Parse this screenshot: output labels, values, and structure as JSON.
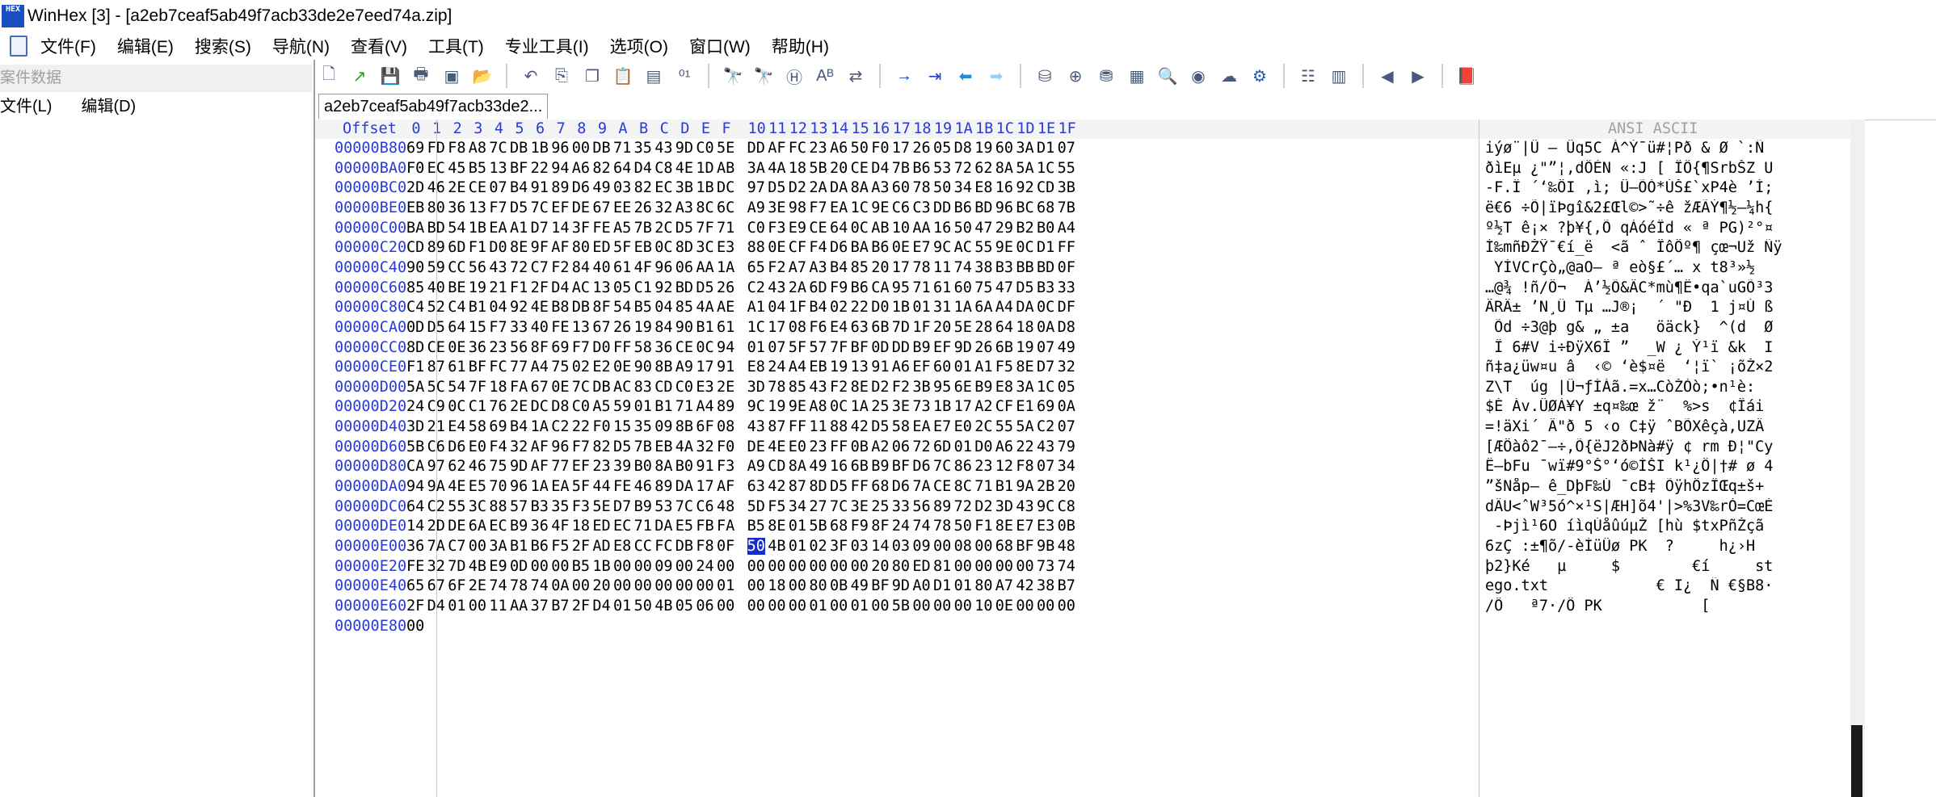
{
  "window": {
    "title": "WinHex [3] - [a2eb7ceaf5ab49f7acb33de2e7eed74a.zip]",
    "logo_text": "HEX"
  },
  "menu": [
    "文件(F)",
    "编辑(E)",
    "搜索(S)",
    "导航(N)",
    "查看(V)",
    "工具(T)",
    "专业工具(I)",
    "选项(O)",
    "窗口(W)",
    "帮助(H)"
  ],
  "toolbar_icons": [
    "new-file-icon",
    "open-icon",
    "save-icon",
    "print-icon",
    "properties-icon",
    "open-folder-icon",
    "undo-icon",
    "copy-icon",
    "copy-block-icon",
    "paste-icon",
    "paste-hex-icon",
    "binary-icon",
    "find-icon",
    "find-replace-icon",
    "find-hex-icon",
    "replace-text-icon",
    "replace-hex-icon",
    "goto-offset-icon",
    "goto-block-icon",
    "back-arrow-icon",
    "forward-arrow-icon",
    "disk-icon",
    "disk-add-icon",
    "disk-clone-icon",
    "calculator-icon",
    "zoom-icon",
    "zoom-out-icon",
    "hand-icon",
    "gear-icon",
    "data-view-icon",
    "table-icon",
    "prev-icon",
    "next-icon",
    "help-book-icon"
  ],
  "left_panel": {
    "header": "案件数据",
    "menu": [
      "文件(L)",
      "编辑(D)"
    ]
  },
  "tab": {
    "label": "a2eb7ceaf5ab49f7acb33de2..."
  },
  "hex": {
    "header_offset": "Offset",
    "header_cols": [
      "0",
      "1",
      "2",
      "3",
      "4",
      "5",
      "6",
      "7",
      "8",
      "9",
      "A",
      "B",
      "C",
      "D",
      "E",
      "F",
      "10",
      "11",
      "12",
      "13",
      "14",
      "15",
      "16",
      "17",
      "18",
      "19",
      "1A",
      "1B",
      "1C",
      "1D",
      "1E",
      "1F"
    ],
    "header_ansi": "ANSI ASCII",
    "rows": [
      {
        "o": "00000B80",
        "h": "69 FD F8 A8 7C DB 1B 96 00 DB 71 35 43 9D C0 5E DD AF FC 23 A6 50 F0 17 26 05 D8 19 60 3A D1 07",
        "a": "iýø¨|Û – Ûq5C À^Ý¯ü#¦Pð & Ø `:Ñ"
      },
      {
        "o": "00000BA0",
        "h": "F0 EC 45 B5 13 BF 22 94 A6 82 64 D4 C8 4E 1D AB 3A 4A 18 5B 20 CE D4 7B B6 53 72 62 8A 5A 1C 55",
        "a": "ðìEµ ¿\"”¦‚dÔÈN «:J [ ÎÔ{¶SrbŠZ U"
      },
      {
        "o": "00000BC0",
        "h": "2D 46 2E CE 07 B4 91 89 D6 49 03 82 EC 3B 1B DC 97 D5 D2 2A DA 8A A3 60 78 50 34 E8 16 92 CD 3B",
        "a": "-F.Î ´‘‰ÖI ‚ì; Ü—ÕÒ*ÚŠ£`xP4è ’Í;"
      },
      {
        "o": "00000BE0",
        "h": "EB 80 36 13 F7 D5 7C EF DE 67 EE 26 32 A3 8C 6C A9 3E 98 F7 EA 1C 9E C6 C3 DD B6 BD 96 BC 68 7B",
        "a": "ë€6 ÷Õ|ïÞgî&2£Œl©>˜÷ê žÆÃÝ¶½–¼h{"
      },
      {
        "o": "00000C00",
        "h": "BA BD 54 1B EA A1 D7 14 3F FE A5 7B 2C D5 7F 71 C0 F3 E9 CE 64 0C AB 10 AA 16 50 47 29 B2 B0 A4",
        "a": "º½T ê¡× ?þ¥{,Õ qÀóéÎd « ª PG)²°¤"
      },
      {
        "o": "00000C20",
        "h": "CD 89 6D F1 D0 8E 9F AF 80 ED 5F EB 0C 8D 3C E3 88 0E CF F4 D6 BA B6 0E E7 9C AC 55 9E 0C D1 FF",
        "a": "Í‰mñÐŽŸ¯€í_ë  <ã ˆ ÏôÖº¶ çœ¬Už Ñÿ"
      },
      {
        "o": "00000C40",
        "h": "90 59 CC 56 43 72 C7 F2 84 40 61 4F 96 06 AA 1A 65 F2 A7 A3 B4 85 20 17 78 11 74 38 B3 BB BD 0F",
        "a": " YÌVCrÇò„@aO– ª eò§£´… x t8³»½"
      },
      {
        "o": "00000C60",
        "h": "85 40 BE 19 21 F1 2F D4 AC 13 05 C1 92 BD D5 26 C2 43 2A 6D F9 B6 CA 95 71 61 60 75 47 D5 B3 33",
        "a": "…@¾ !ñ/Ô¬  Á’½Õ&ÂC*mù¶Ê•qa`uGÕ³3"
      },
      {
        "o": "00000C80",
        "h": "C4 52 C4 B1 04 92 4E B8 DB 8F 54 B5 04 85 4A AE A1 04 1F B4 02 22 D0 1B 01 31 1A 6A A4 DA 0C DF",
        "a": "ÄRÄ± ’N¸Û Tµ …J®¡  ´ \"Ð  1 j¤Ú ß"
      },
      {
        "o": "00000CA0",
        "h": "0D D5 64 15 F7 33 40 FE 13 67 26 19 84 90 B1 61 1C 17 08 F6 E4 63 6B 7D 1F 20 5E 28 64 18 0A D8",
        "a": " Õd ÷3@þ g& „ ±a   öäck}  ^(d  Ø"
      },
      {
        "o": "00000CC0",
        "h": "8D CE 0E 36 23 56 8F 69 F7 D0 FF 58 36 CE 0C 94 01 07 5F 57 7F BF 0D DD B9 EF 9D 26 6B 19 07 49",
        "a": " Î 6#V i÷ÐÿX6Î ”  _W ¿ Ý¹ï &k  I"
      },
      {
        "o": "00000CE0",
        "h": "F1 87 61 BF FC 77 A4 75 02 E2 0E 90 8B A9 17 91 E8 24 A4 EB 19 13 91 A6 EF 60 01 A1 F5 8E D7 32",
        "a": "ñ‡a¿üw¤u â  ‹© ‘è$¤ë  ‘¦ï` ¡õŽ×2"
      },
      {
        "o": "00000D00",
        "h": "5A 5C 54 7F 18 FA 67 0E 7C DB AC 83 CD C0 E3 2E 3D 78 85 43 F2 8E D2 F2 3B 95 6E B9 E8 3A 1C 05",
        "a": "Z\\T  úg |Û¬ƒÍÀã.=x…CòŽÒò;•n¹è:  "
      },
      {
        "o": "00000D20",
        "h": "24 C9 0C C1 76 2E DC D8 C0 A5 59 01 B1 71 A4 89 9C 19 9E A8 0C 1A 25 3E 73 1B 17 A2 CF E1 69 0A",
        "a": "$É Áv.ÜØÀ¥Y ±q¤‰œ ž¨  %>s  ¢Ïái "
      },
      {
        "o": "00000D40",
        "h": "3D 21 E4 58 69 B4 1A C2 22 F0 15 35 09 8B 6F 08 43 87 FF 11 88 42 D5 58 EA E7 E0 2C 55 5A C2 07",
        "a": "=!äXi´ Â\"ð 5 ‹o C‡ÿ ˆBÕXêçà,UZÂ "
      },
      {
        "o": "00000D60",
        "h": "5B C6 D6 E0 F4 32 AF 96 F7 82 D5 7B EB 4A 32 F0 DE 4E E0 23 FF 0B A2 06 72 6D 01 D0 A6 22 43 79",
        "a": "[ÆÖàô2¯–÷‚Õ{ëJ2ðÞNà#ÿ ¢ rm Ð¦\"Cy"
      },
      {
        "o": "00000D80",
        "h": "CA 97 62 46 75 9D AF 77 EF 23 39 B0 8A B0 91 F3 A9 CD 8A 49 16 6B B9 BF D6 7C 86 23 12 F8 07 34",
        "a": "Ê—bFu ¯wï#9°Š°‘ó©ÍŠI k¹¿Ö|†# ø 4"
      },
      {
        "o": "00000DA0",
        "h": "94 9A 4E E5 70 96 1A EA 5F 44 FE 46 89 DA 17 AF 63 42 87 8D D5 FF 68 D6 7A CE 8C 71 B1 9A 2B 20",
        "a": "”šNåp– ê_DþF‰Ú ¯cB‡ ÕÿhÖzÎŒq±š+ "
      },
      {
        "o": "00000DC0",
        "h": "64 C2 55 3C 88 57 B3 35 F3 5E D7 B9 53 7C C6 48 5D F5 34 27 7C 3E 25 33 56 89 72 D2 3D 43 9C C8",
        "a": "dÂU<ˆW³5ó^×¹S|ÆH]õ4'|>%3V‰rÒ=CœÈ"
      },
      {
        "o": "00000DE0",
        "h": "14 2D DE 6A EC B9 36 4F 18 ED EC 71 DA E5 FB FA B5 8E 01 5B 68 F9 8F 24 74 78 50 F1 8E E7 E3 0B",
        "a": " -Þjì¹6O íìqÚåûúµŽ [hù $txPñŽçã"
      },
      {
        "o": "00000E00",
        "h": "36 7A C7 00 3A B1 B6 F5 2F AD E8 CC FC DB F8 0F 50 4B 01 02 3F 03 14 03 09 00 08 00 68 BF 9B 48",
        "a": "6zÇ :±¶õ/-èÌüÛø PK  ?     h¿›H"
      },
      {
        "o": "00000E20",
        "h": "FE 32 7D 4B E9 0D 00 00 B5 1B 00 00 09 00 24 00 00 00 00 00 00 00 20 80 ED 81 00 00 00 00 73 74",
        "a": "þ2}Ké   µ     $        €í     st"
      },
      {
        "o": "00000E40",
        "h": "65 67 6F 2E 74 78 74 0A 00 20 00 00 00 00 00 01 00 18 00 80 0B 49 BF 9D A0 D1 01 80 A7 42 38 B7",
        "a": "ego.txt            € I¿  Ñ €§B8·"
      },
      {
        "o": "00000E60",
        "h": "2F D4 01 00 11 AA 37 B7 2F D4 01 50 4B 05 06 00 00 00 00 01 00 01 00 5B 00 00 00 10 0E 00 00 00",
        "a": "/Ô   ª7·/Ô PK           [     "
      },
      {
        "o": "00000E80",
        "h": "00",
        "a": ""
      }
    ],
    "selected_hex": {
      "row": 20,
      "col": 16,
      "text": "50"
    },
    "selected_ascii": {
      "row": 20,
      "text": "P"
    }
  }
}
